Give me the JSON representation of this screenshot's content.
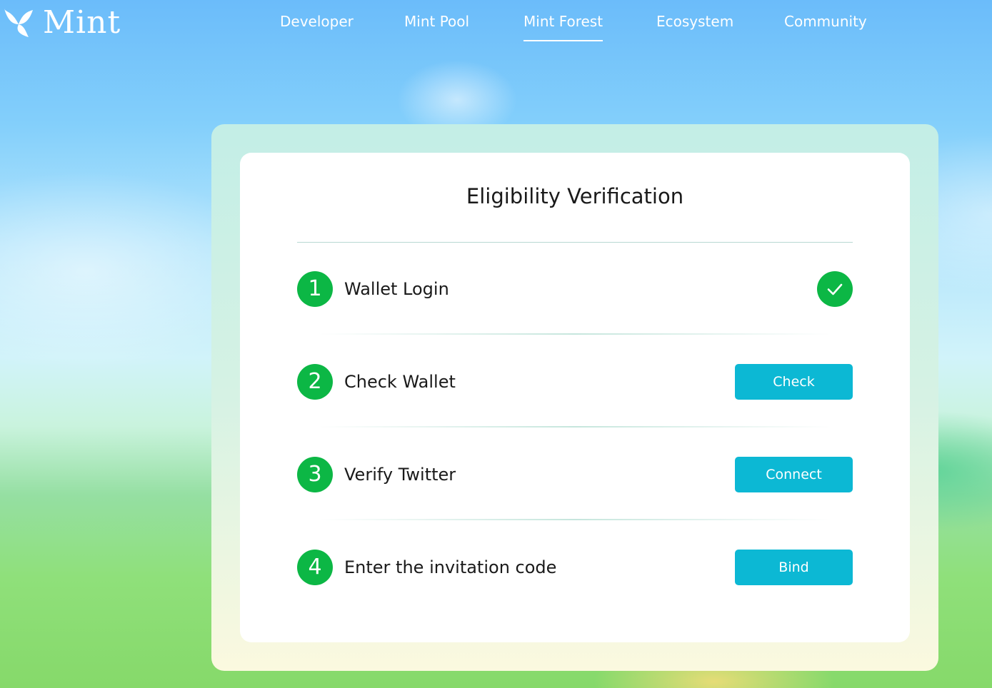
{
  "brand": {
    "logo_text": "Mint",
    "logo_icon": "leaf-icon"
  },
  "nav": {
    "items": [
      {
        "label": "Developer"
      },
      {
        "label": "Mint Pool"
      },
      {
        "label": "Mint Forest",
        "active": true
      },
      {
        "label": "Ecosystem"
      },
      {
        "label": "Community"
      }
    ]
  },
  "card": {
    "title": "Eligibility Verification",
    "steps": [
      {
        "number": "1",
        "label": "Wallet Login",
        "status": "completed",
        "status_icon": "checkmark-icon"
      },
      {
        "number": "2",
        "label": "Check Wallet",
        "action_label": "Check"
      },
      {
        "number": "3",
        "label": "Verify Twitter",
        "action_label": "Connect"
      },
      {
        "number": "4",
        "label": "Enter the invitation code",
        "action_label": "Bind"
      }
    ]
  },
  "colors": {
    "step_green": "#0cb745",
    "action_cyan": "#0cb8d4",
    "sky_blue": "#6bbcfa",
    "grass_green": "#86d96a"
  }
}
